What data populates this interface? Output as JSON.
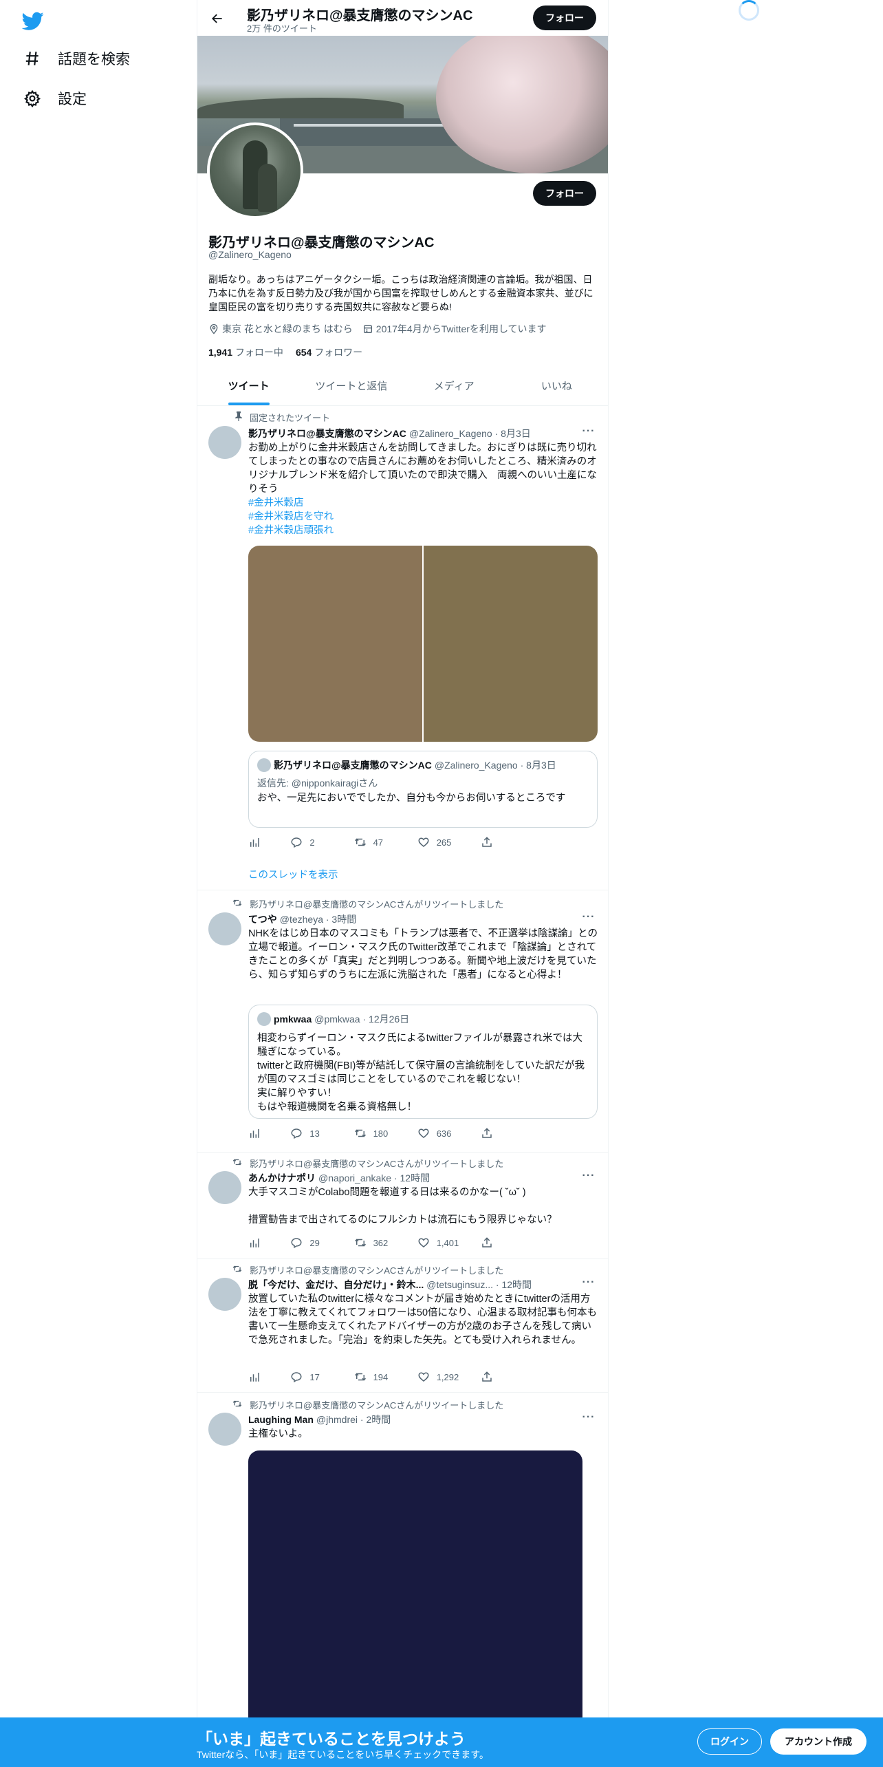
{
  "nav": {
    "items": [
      {
        "label": "話題を検索"
      },
      {
        "label": "設定"
      }
    ]
  },
  "topbar": {
    "name": "影乃ザリネロ@暴支膺懲のマシンAC",
    "tweet_count": "2万 件のツイート",
    "follow_label": "フォロー"
  },
  "profile": {
    "follow_label": "フォロー",
    "name": "影乃ザリネロ@暴支膺懲のマシンAC",
    "handle": "@Zalinero_Kageno",
    "bio": "副垢なり。あっちはアニゲータクシー垢。こっちは政治経済関連の言論垢。我が祖国、日乃本に仇を為す反日勢力及び我が国から国富を搾取せしめんとする金融資本家共、並びに皇国臣民の富を切り売りする売国奴共に容赦など要らぬ!",
    "location": "東京 花と水と緑のまち はむら",
    "joined": "2017年4月からTwitterを利用しています",
    "following_count": "1,941",
    "following_label": "フォロー中",
    "followers_count": "654",
    "followers_label": "フォロワー"
  },
  "tabs": [
    {
      "label": "ツイート"
    },
    {
      "label": "ツイートと返信"
    },
    {
      "label": "メディア"
    },
    {
      "label": "いいね"
    }
  ],
  "tweets": [
    {
      "social": "固定されたツイート",
      "name": "影乃ザリネロ@暴支膺懲のマシンAC",
      "handle": "@Zalinero_Kageno · 8月3日",
      "text": "お勤め上がりに金井米穀店さんを訪問してきました。おにぎりは既に売り切れてしまったとの事なので店員さんにお薦めをお伺いしたところ、精米済みのオリジナルブレンド米を紹介して頂いたので即決で購入　両親へのいい土産になりそう",
      "tags": [
        "#金井米穀店",
        "#金井米穀店を守れ",
        "#金井米穀店頑張れ"
      ],
      "quote": {
        "name": "影乃ザリネロ@暴支膺懲のマシンAC",
        "handle": "@Zalinero_Kageno · 8月3日",
        "reply_to": "返信先: @nipponkairagiさん",
        "text": "おや、一足先においででしたか、自分も今からお伺いするところです"
      },
      "replies": "2",
      "retweets": "47",
      "likes": "265",
      "show_thread": "このスレッドを表示"
    },
    {
      "social": "影乃ザリネロ@暴支膺懲のマシンACさんがリツイートしました",
      "name": "てつや",
      "handle": "@tezheya · 3時間",
      "text": "NHKをはじめ日本のマスコミも「トランプは悪者で、不正選挙は陰謀論」との立場で報道。イーロン・マスク氏のTwitter改革でこれまで「陰謀論」とされてきたことの多くが「真実」だと判明しつつある。新聞や地上波だけを見ていたら、知らず知らずのうちに左派に洗脳された「愚者」になると心得よ！",
      "quote": {
        "name": "pmkwaa",
        "handle": "@pmkwaa · 12月26日",
        "text": "相変わらずイーロン・マスク氏によるtwitterファイルが暴露され米では大騒ぎになっている。\ntwitterと政府機関(FBI)等が結託して保守層の言論統制をしていた訳だが我が国のマスゴミは同じことをしているのでこれを報じない！\n実に解りやすい！\nもはや報道機関を名乗る資格無し！"
      },
      "replies": "13",
      "retweets": "180",
      "likes": "636"
    },
    {
      "social": "影乃ザリネロ@暴支膺懲のマシンACさんがリツイートしました",
      "name": "あんかけナポリ",
      "handle": "@napori_ankake · 12時間",
      "text": "大手マスコミがColabo問題を報道する日は来るのかなー( ˘ω˘ )\n\n措置勧告まで出されてるのにフルシカトは流石にもう限界じゃない？",
      "replies": "29",
      "retweets": "362",
      "likes": "1,401"
    },
    {
      "social": "影乃ザリネロ@暴支膺懲のマシンACさんがリツイートしました",
      "name": "脱「今だけ、金だけ、自分だけ」・鈴木...",
      "handle": "@tetsuginsuz... · 12時間",
      "text": "放置していた私のtwitterに様々なコメントが届き始めたときにtwitterの活用方法を丁寧に教えてくれてフォロワーは50倍になり、心温まる取材記事も何本も書いて一生懸命支えてくれたアドバイザーの方が2歳のお子さんを残して病いで急死されました。「完治」を約束した矢先。とても受け入れられません。",
      "replies": "17",
      "retweets": "194",
      "likes": "1,292"
    },
    {
      "social": "影乃ザリネロ@暴支膺懲のマシンACさんがリツイートしました",
      "name": "Laughing Man",
      "handle": "@jhmdrei · 2時間",
      "text": "主権ないよ。"
    }
  ],
  "bottom": {
    "title": "「いま」起きていることを見つけよう",
    "subtitle": "Twitterなら、「いま」起きていることをいち早くチェックできます。",
    "login": "ログイン",
    "signup": "アカウント作成"
  },
  "colors": {
    "accent": "#1d9bf0",
    "text": "#0f1419",
    "muted": "#536471",
    "image_left": "#8a7457",
    "image_right": "#81714f",
    "image_dark": "#181a40"
  }
}
